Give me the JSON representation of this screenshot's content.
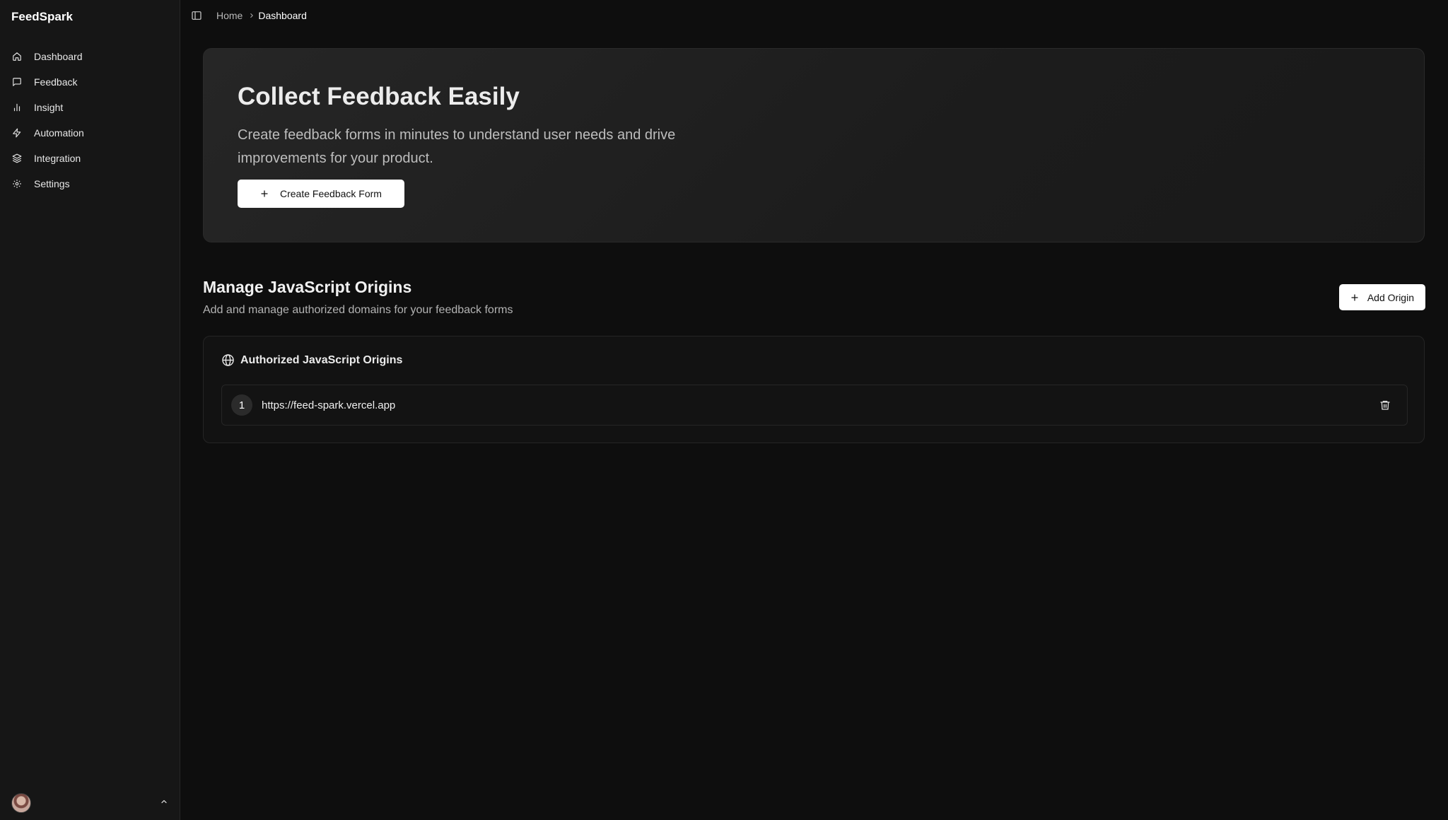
{
  "app": {
    "brand": "FeedSpark"
  },
  "sidebar": {
    "items": [
      {
        "label": "Dashboard",
        "icon": "home-icon"
      },
      {
        "label": "Feedback",
        "icon": "message-square-icon"
      },
      {
        "label": "Insight",
        "icon": "bar-chart-icon"
      },
      {
        "label": "Automation",
        "icon": "zap-icon"
      },
      {
        "label": "Integration",
        "icon": "layers-icon"
      },
      {
        "label": "Settings",
        "icon": "gear-icon"
      }
    ],
    "footer": {
      "avatar": "user-avatar",
      "toggle_icon": "chevron-up-icon"
    }
  },
  "topbar": {
    "toggle_icon": "sidebar-toggle-icon",
    "breadcrumb": {
      "home": "Home",
      "current": "Dashboard"
    }
  },
  "hero": {
    "title": "Collect Feedback Easily",
    "description": "Create feedback forms in minutes to understand user needs and drive improvements for your product.",
    "button_label": "Create Feedback Form"
  },
  "origins_section": {
    "title": "Manage JavaScript Origins",
    "subtitle": "Add and manage authorized domains for your feedback forms",
    "add_button_label": "Add Origin",
    "card_title": "Authorized JavaScript Origins",
    "items": [
      {
        "index": "1",
        "url": "https://feed-spark.vercel.app"
      }
    ]
  },
  "colors": {
    "background": "#0e0e0e",
    "sidebar": "#161616",
    "hero_card": "#232323",
    "primary_button": "#ffffff"
  }
}
